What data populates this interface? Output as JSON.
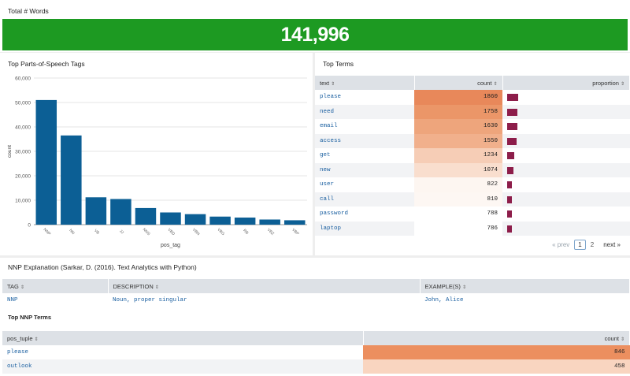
{
  "total_words": {
    "title": "Total # Words",
    "value": "141,996",
    "color": "#1d9a22"
  },
  "pos_chart": {
    "title": "Top Parts-of-Speech Tags",
    "chart_data": {
      "type": "bar",
      "xlabel": "pos_tag",
      "ylabel": "count",
      "ylim": [
        0,
        60000
      ],
      "yticks": [
        "0",
        "10,000",
        "20,000",
        "30,000",
        "40,000",
        "50,000",
        "60,000"
      ],
      "categories": [
        "NNP",
        "NN",
        "VB",
        "JJ",
        "NNS",
        "VBD",
        "VBN",
        "VBG",
        "RB",
        "VBZ",
        "VBP"
      ],
      "values": [
        51000,
        36500,
        11200,
        10500,
        6800,
        5000,
        4300,
        3300,
        2900,
        2100,
        1800
      ],
      "color": "#0c5f95",
      "grid": true
    }
  },
  "top_terms": {
    "title": "Top Terms",
    "columns": [
      "text",
      "count",
      "proportion"
    ],
    "rows": [
      {
        "text": "please",
        "count": "1860",
        "proportion": 0.65,
        "heat": "#e8885a"
      },
      {
        "text": "need",
        "count": "1758",
        "proportion": 0.61,
        "heat": "#eb9668"
      },
      {
        "text": "email",
        "count": "1630",
        "proportion": 0.57,
        "heat": "#eea57c"
      },
      {
        "text": "access",
        "count": "1550",
        "proportion": 0.55,
        "heat": "#f1b08c"
      },
      {
        "text": "get",
        "count": "1234",
        "proportion": 0.43,
        "heat": "#f6cdb6"
      },
      {
        "text": "new",
        "count": "1074",
        "proportion": 0.38,
        "heat": "#f9dece"
      },
      {
        "text": "user",
        "count": "822",
        "proportion": 0.29,
        "heat": "#fdf6f1"
      },
      {
        "text": "call",
        "count": "810",
        "proportion": 0.28,
        "heat": "#fdf7f3"
      },
      {
        "text": "password",
        "count": "788",
        "proportion": 0.28,
        "heat": "#ffffff"
      },
      {
        "text": "laptop",
        "count": "786",
        "proportion": 0.28,
        "heat": "#ffffff"
      }
    ],
    "pager": {
      "prev": "« prev",
      "page1": "1",
      "page2": "2",
      "next": "next »"
    }
  },
  "nnp": {
    "title": "NNP Explanation (Sarkar, D. (2016). Text Analytics with Python)",
    "columns": [
      "TAG",
      "DESCRIPTION",
      "EXAMPLE(S)"
    ],
    "row": {
      "tag": "NNP",
      "description": "Noun, proper singular",
      "examples": "John, Alice"
    },
    "sub_title": "Top NNP Terms",
    "top_columns": [
      "pos_tuple",
      "count"
    ],
    "top_rows": [
      {
        "term": "please",
        "count": "846",
        "heat": "#ec8f5f"
      },
      {
        "term": "outlook",
        "count": "458",
        "heat": "#f9d5c0"
      }
    ]
  },
  "sort_icon": "⇕"
}
